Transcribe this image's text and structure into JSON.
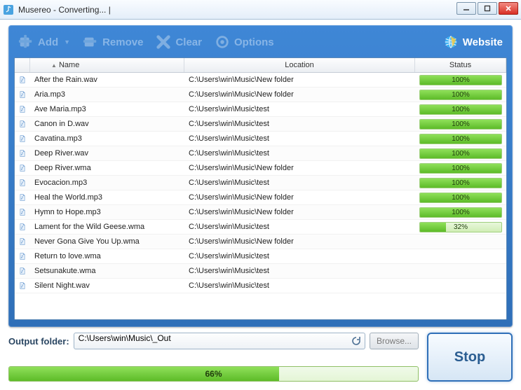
{
  "window": {
    "title": "Musereo - Converting...  |"
  },
  "toolbar": {
    "add": "Add",
    "remove": "Remove",
    "clear": "Clear",
    "options": "Options",
    "website": "Website"
  },
  "columns": {
    "name": "Name",
    "location": "Location",
    "status": "Status"
  },
  "files": [
    {
      "name": "After the Rain.wav",
      "location": "C:\\Users\\win\\Music\\New folder",
      "pct": 100
    },
    {
      "name": "Aria.mp3",
      "location": "C:\\Users\\win\\Music\\New folder",
      "pct": 100
    },
    {
      "name": "Ave Maria.mp3",
      "location": "C:\\Users\\win\\Music\\test",
      "pct": 100
    },
    {
      "name": "Canon in D.wav",
      "location": "C:\\Users\\win\\Music\\test",
      "pct": 100
    },
    {
      "name": "Cavatina.mp3",
      "location": "C:\\Users\\win\\Music\\test",
      "pct": 100
    },
    {
      "name": "Deep River.wav",
      "location": "C:\\Users\\win\\Music\\test",
      "pct": 100
    },
    {
      "name": "Deep River.wma",
      "location": "C:\\Users\\win\\Music\\New folder",
      "pct": 100
    },
    {
      "name": "Evocacion.mp3",
      "location": "C:\\Users\\win\\Music\\test",
      "pct": 100
    },
    {
      "name": "Heal the World.mp3",
      "location": "C:\\Users\\win\\Music\\New folder",
      "pct": 100
    },
    {
      "name": "Hymn to Hope.mp3",
      "location": "C:\\Users\\win\\Music\\New folder",
      "pct": 100
    },
    {
      "name": "Lament for the Wild Geese.wma",
      "location": "C:\\Users\\win\\Music\\test",
      "pct": 32
    },
    {
      "name": "Never Gona Give You Up.wma",
      "location": "C:\\Users\\win\\Music\\New folder",
      "pct": null
    },
    {
      "name": "Return to love.wma",
      "location": "C:\\Users\\win\\Music\\test",
      "pct": null
    },
    {
      "name": "Setsunakute.wma",
      "location": "C:\\Users\\win\\Music\\test",
      "pct": null
    },
    {
      "name": "Silent Night.wav",
      "location": "C:\\Users\\win\\Music\\test",
      "pct": null
    }
  ],
  "output": {
    "label": "Output folder:",
    "path": "C:\\Users\\win\\Music\\_Out",
    "browse": "Browse..."
  },
  "progress": {
    "overall_pct": 66
  },
  "buttons": {
    "stop": "Stop"
  }
}
